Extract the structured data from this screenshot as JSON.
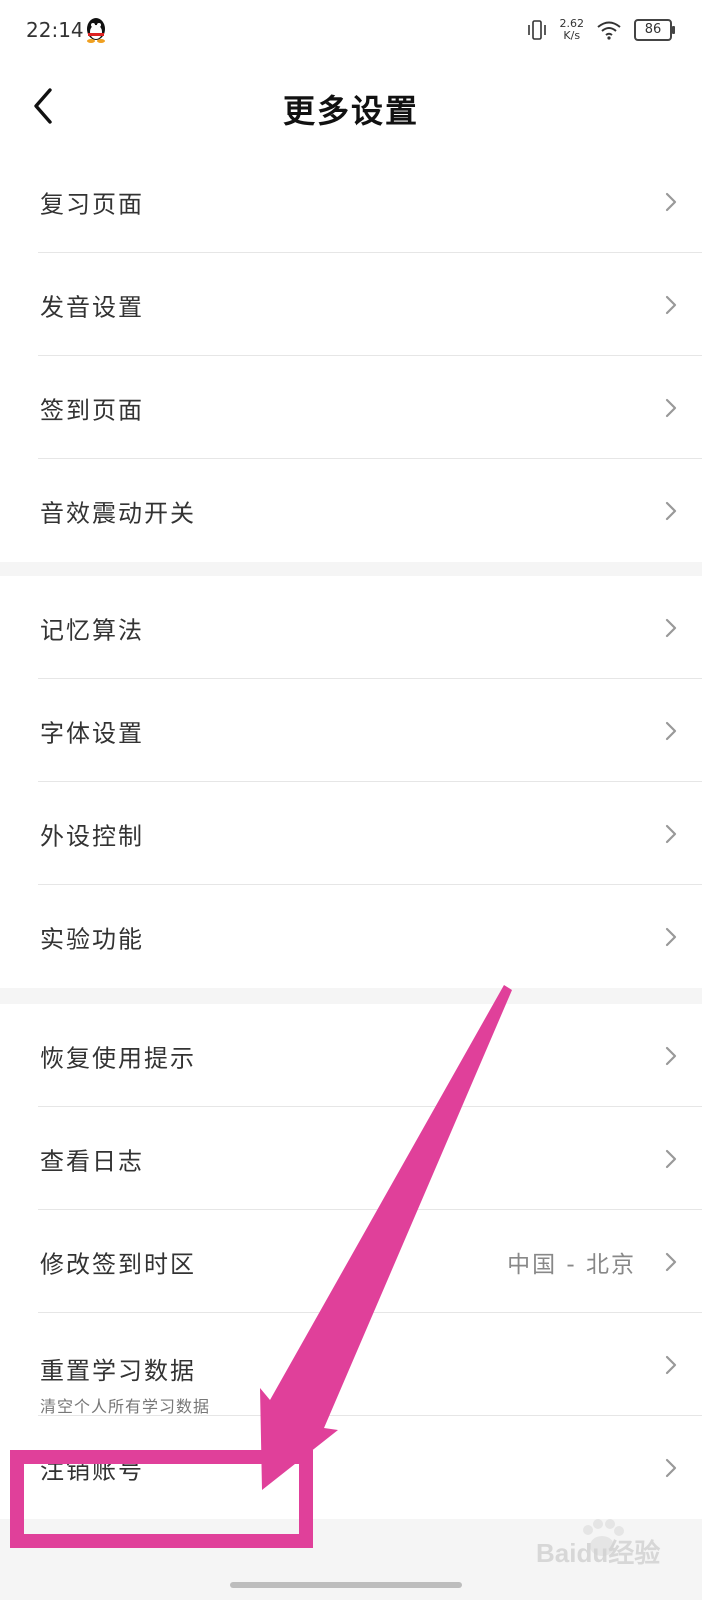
{
  "status_bar": {
    "time": "22:14",
    "speed_value": "2.62",
    "speed_unit": "K/s",
    "battery": "86",
    "icons": [
      "qq-icon",
      "vibrate-icon",
      "wifi-icon",
      "battery-icon"
    ]
  },
  "header": {
    "title": "更多设置",
    "back_icon": "chevron-left-icon"
  },
  "groups": [
    {
      "items": [
        {
          "label": "复习页面"
        },
        {
          "label": "发音设置"
        },
        {
          "label": "签到页面"
        },
        {
          "label": "音效震动开关"
        }
      ]
    },
    {
      "items": [
        {
          "label": "记忆算法"
        },
        {
          "label": "字体设置"
        },
        {
          "label": "外设控制"
        },
        {
          "label": "实验功能"
        }
      ]
    },
    {
      "items": [
        {
          "label": "恢复使用提示"
        },
        {
          "label": "查看日志"
        },
        {
          "label": "修改签到时区",
          "value": "中国 - 北京"
        },
        {
          "label": "重置学习数据",
          "sublabel": "清空个人所有学习数据"
        },
        {
          "label": "注销账号"
        }
      ]
    }
  ],
  "colors": {
    "annotation": "#e0409a",
    "background": "#f5f5f5",
    "row_background": "#ffffff",
    "chevron": "#999999"
  },
  "watermark": "Baidu经验"
}
